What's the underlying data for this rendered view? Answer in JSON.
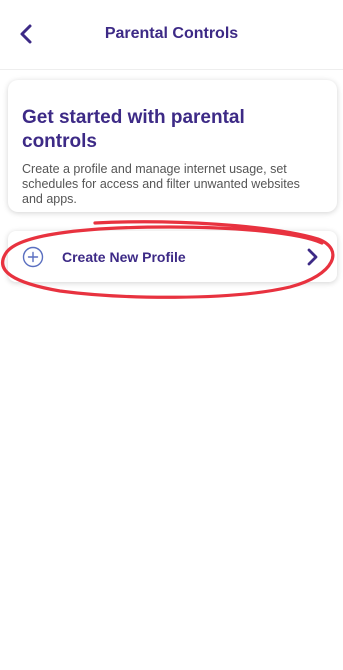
{
  "header": {
    "title": "Parental Controls",
    "back_icon": "chevron-left-icon"
  },
  "info_card": {
    "title": "Get started with parental controls",
    "description": "Create a profile and manage internet usage, set schedules for access and filter unwanted websites and apps."
  },
  "profile_row": {
    "label": "Create New Profile",
    "leading_icon": "plus-circle-icon",
    "trailing_icon": "chevron-right-icon"
  },
  "colors": {
    "brand_purple": "#3d2a86",
    "icon_blue": "#5a6fc0",
    "annotation_red": "#e8323f",
    "body_text": "#555555"
  }
}
